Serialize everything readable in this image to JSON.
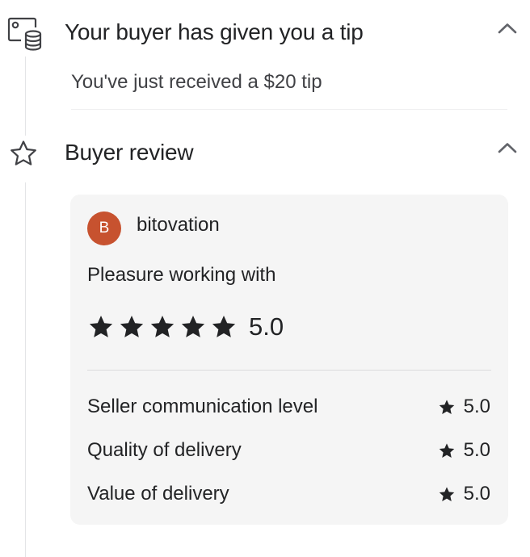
{
  "tip_section": {
    "title": "Your buyer has given you a tip",
    "message": "You've just received a $20 tip",
    "icon": "tip-money-icon"
  },
  "review_section": {
    "title": "Buyer review",
    "icon": "star-outline-icon",
    "reviewer": {
      "initial": "B",
      "name": "bitovation",
      "avatar_color": "#c7522f"
    },
    "review_text": "Pleasure working with",
    "overall_rating": "5.0",
    "overall_stars": 5,
    "ratings": [
      {
        "label": "Seller communication level",
        "value": "5.0"
      },
      {
        "label": "Quality of delivery",
        "value": "5.0"
      },
      {
        "label": "Value of delivery",
        "value": "5.0"
      }
    ]
  }
}
